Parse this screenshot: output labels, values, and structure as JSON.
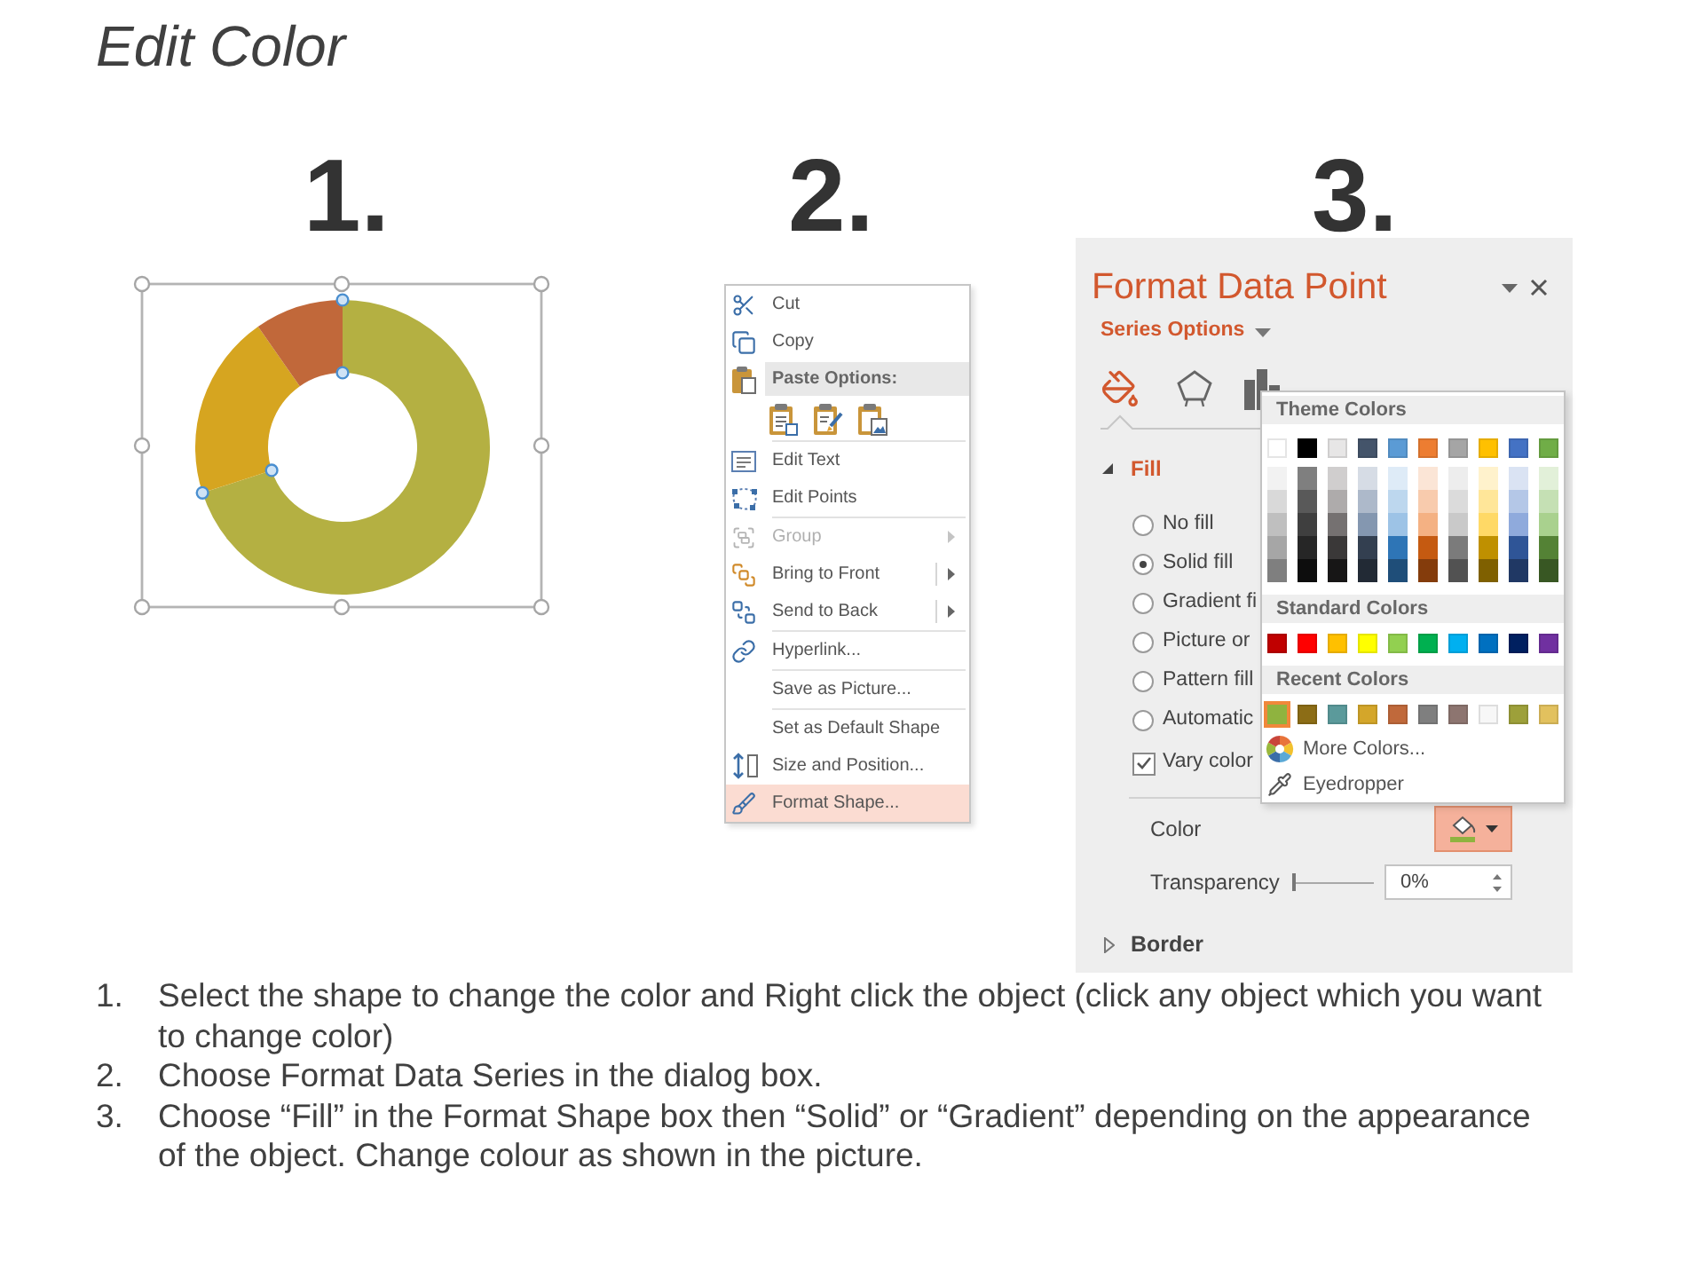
{
  "title": "Edit Color",
  "steps": [
    {
      "number": "1."
    },
    {
      "number": "2."
    },
    {
      "number": "3."
    }
  ],
  "donut": {
    "slices": [
      {
        "color": "#b4b042"
      },
      {
        "color": "#d6a520"
      },
      {
        "color": "#c1683a"
      }
    ]
  },
  "menu": {
    "items": [
      {
        "kind": "item",
        "label": "Cut",
        "disabled": false,
        "submenu": false,
        "selected": false
      },
      {
        "kind": "item",
        "label": "Copy",
        "disabled": false,
        "submenu": false,
        "selected": false
      },
      {
        "kind": "header",
        "label": "Paste Options:"
      },
      {
        "kind": "paste_icons"
      },
      {
        "kind": "separator"
      },
      {
        "kind": "item",
        "label": "Edit Text",
        "disabled": false,
        "submenu": false,
        "selected": false
      },
      {
        "kind": "item",
        "label": "Edit Points",
        "disabled": false,
        "submenu": false,
        "selected": false
      },
      {
        "kind": "separator"
      },
      {
        "kind": "item",
        "label": "Group",
        "disabled": true,
        "submenu": true,
        "selected": false
      },
      {
        "kind": "item",
        "label": "Bring to Front",
        "disabled": false,
        "submenu": true,
        "selected": false
      },
      {
        "kind": "item",
        "label": "Send to Back",
        "disabled": false,
        "submenu": true,
        "selected": false
      },
      {
        "kind": "separator"
      },
      {
        "kind": "item",
        "label": "Hyperlink...",
        "disabled": false,
        "submenu": false,
        "selected": false
      },
      {
        "kind": "separator"
      },
      {
        "kind": "item",
        "label": "Save as Picture...",
        "disabled": false,
        "submenu": false,
        "selected": false
      },
      {
        "kind": "separator"
      },
      {
        "kind": "item",
        "label": "Set as Default Shape",
        "disabled": false,
        "submenu": false,
        "selected": false
      },
      {
        "kind": "item",
        "label": "Size and Position...",
        "disabled": false,
        "submenu": false,
        "selected": false
      },
      {
        "kind": "item",
        "label": "Format Shape...",
        "disabled": false,
        "submenu": false,
        "selected": true
      }
    ]
  },
  "format_panel": {
    "title": "Format Data Point",
    "series_label": "Series Options",
    "option_tabs": [
      {
        "selected": true
      },
      {
        "selected": false
      },
      {
        "selected": false
      }
    ],
    "fill": {
      "label": "Fill",
      "expanded": true,
      "options": [
        {
          "label": "No fill",
          "selected": false
        },
        {
          "label": "Solid fill",
          "selected": true
        },
        {
          "label": "Gradient fi",
          "selected": false
        },
        {
          "label": "Picture or",
          "selected": false
        },
        {
          "label": "Pattern fill",
          "selected": false
        },
        {
          "label": "Automatic",
          "selected": false
        }
      ],
      "vary_colors": {
        "label": "Vary color",
        "checked": true
      },
      "color_label": "Color",
      "transparency": {
        "label": "Transparency",
        "level": 0,
        "value": "0%"
      }
    },
    "border": {
      "label": "Border",
      "expanded": false
    },
    "color_menu": {
      "sections": [
        {
          "kind": "theme",
          "label": "Theme Colors",
          "rows": [
            [
              {
                "color": "#ffffff"
              },
              {
                "color": "#000000"
              },
              {
                "color": "#e7e6e6"
              },
              {
                "color": "#44546a"
              },
              {
                "color": "#5b9bd5"
              },
              {
                "color": "#ed7d31"
              },
              {
                "color": "#a5a5a5"
              },
              {
                "color": "#ffc000"
              },
              {
                "color": "#4472c4"
              },
              {
                "color": "#70ad47"
              }
            ],
            [
              {
                "color": "#f2f2f2"
              },
              {
                "color": "#7f7f7f"
              },
              {
                "color": "#d0cece"
              },
              {
                "color": "#d6dce5"
              },
              {
                "color": "#deebf7"
              },
              {
                "color": "#fbe5d6"
              },
              {
                "color": "#ededed"
              },
              {
                "color": "#fff2cc"
              },
              {
                "color": "#dae3f3"
              },
              {
                "color": "#e2f0d9"
              }
            ],
            [
              {
                "color": "#d9d9d9"
              },
              {
                "color": "#595959"
              },
              {
                "color": "#aeabab"
              },
              {
                "color": "#adb9ca"
              },
              {
                "color": "#bdd7ee"
              },
              {
                "color": "#f8cbad"
              },
              {
                "color": "#dbdbdb"
              },
              {
                "color": "#ffe699"
              },
              {
                "color": "#b4c7e7"
              },
              {
                "color": "#c5e0b4"
              }
            ],
            [
              {
                "color": "#bfbfbf"
              },
              {
                "color": "#3f3f3f"
              },
              {
                "color": "#757171"
              },
              {
                "color": "#8497b0"
              },
              {
                "color": "#9dc3e6"
              },
              {
                "color": "#f4b183"
              },
              {
                "color": "#c9c9c9"
              },
              {
                "color": "#ffd966"
              },
              {
                "color": "#8faadc"
              },
              {
                "color": "#a9d18e"
              }
            ],
            [
              {
                "color": "#a6a6a6"
              },
              {
                "color": "#262626"
              },
              {
                "color": "#3a3838"
              },
              {
                "color": "#333f50"
              },
              {
                "color": "#2e75b6"
              },
              {
                "color": "#c55a11"
              },
              {
                "color": "#7b7b7b"
              },
              {
                "color": "#bf9000"
              },
              {
                "color": "#2f5597"
              },
              {
                "color": "#548235"
              }
            ],
            [
              {
                "color": "#7f7f7f"
              },
              {
                "color": "#0d0d0d"
              },
              {
                "color": "#171616"
              },
              {
                "color": "#222a35"
              },
              {
                "color": "#1f4e79"
              },
              {
                "color": "#843c0c"
              },
              {
                "color": "#525252"
              },
              {
                "color": "#7f6000"
              },
              {
                "color": "#203864"
              },
              {
                "color": "#385723"
              }
            ]
          ]
        },
        {
          "kind": "standard",
          "label": "Standard Colors",
          "rows": [
            [
              {
                "color": "#c00000"
              },
              {
                "color": "#ff0000"
              },
              {
                "color": "#ffc000"
              },
              {
                "color": "#ffff00"
              },
              {
                "color": "#92d050"
              },
              {
                "color": "#00b050"
              },
              {
                "color": "#00b0f0"
              },
              {
                "color": "#0070c0"
              },
              {
                "color": "#002060"
              },
              {
                "color": "#7030a0"
              }
            ]
          ]
        },
        {
          "kind": "recent",
          "label": "Recent Colors",
          "rows": [
            [
              {
                "color": "#8fb33f",
                "selected": true
              },
              {
                "color": "#8c6d16",
                "selected": false
              },
              {
                "color": "#5b9a9b",
                "selected": false
              },
              {
                "color": "#d4a62a",
                "selected": false
              },
              {
                "color": "#c0693b",
                "selected": false
              },
              {
                "color": "#7f7f7f",
                "selected": false
              },
              {
                "color": "#8d7570",
                "selected": false
              },
              {
                "color": "#f7f7f7",
                "selected": false
              },
              {
                "color": "#9da03a",
                "selected": false
              },
              {
                "color": "#e2c15e",
                "selected": false
              }
            ]
          ]
        }
      ],
      "actions": [
        {
          "label": "More Colors..."
        },
        {
          "label": "Eyedropper"
        }
      ]
    }
  },
  "instructions": [
    {
      "number": "1.",
      "text": "Select the shape to change the color and Right click the object (click any object which you want to change color)"
    },
    {
      "number": "2.",
      "text": "Choose Format Data Series in the dialog box."
    },
    {
      "number": "3.",
      "text": "Choose “Fill” in the Format Shape box then “Solid” or “Gradient” depending on the appearance of the object. Change colour as shown in the picture."
    }
  ]
}
